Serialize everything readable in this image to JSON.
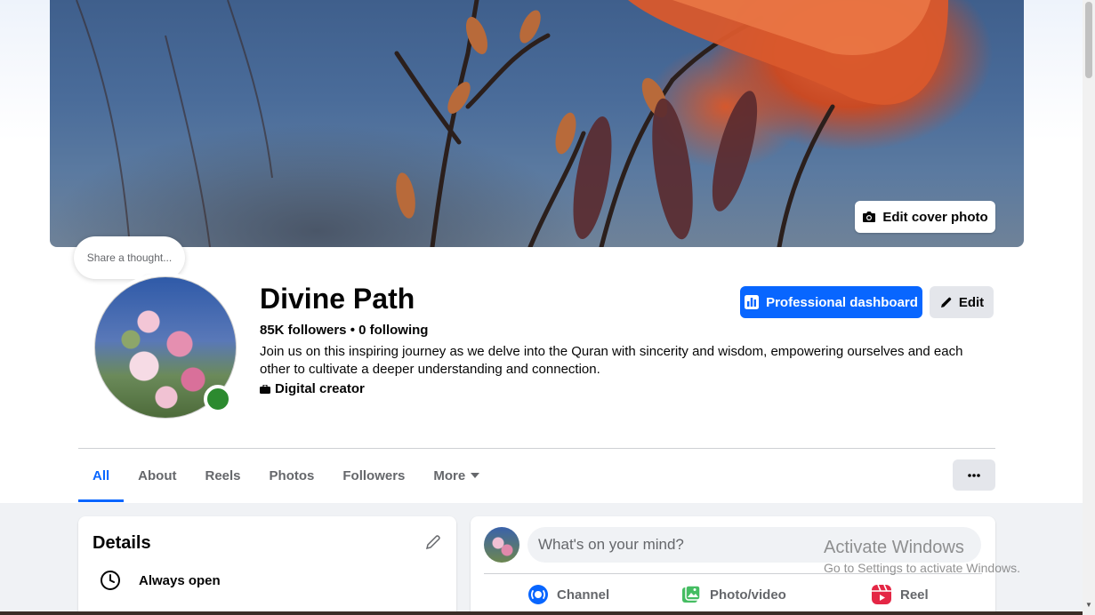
{
  "cover": {
    "edit_label": "Edit cover photo"
  },
  "thought_bubble": {
    "text": "Share a thought..."
  },
  "profile": {
    "name": "Divine Path",
    "followers": "85K followers",
    "separator": " • ",
    "following": "0 following",
    "bio": "Join us on this inspiring journey as we delve into the Quran with sincerity and wisdom, empowering ourselves and each other to cultivate a deeper understanding and connection.",
    "category": "Digital creator",
    "online_status_color": "#2c8a2f"
  },
  "actions": {
    "professional_dashboard": "Professional dashboard",
    "edit": "Edit"
  },
  "tabs": [
    {
      "label": "All",
      "active": true
    },
    {
      "label": "About",
      "active": false
    },
    {
      "label": "Reels",
      "active": false
    },
    {
      "label": "Photos",
      "active": false
    },
    {
      "label": "Followers",
      "active": false
    },
    {
      "label": "More",
      "active": false
    }
  ],
  "details": {
    "title": "Details",
    "hours": "Always open"
  },
  "composer": {
    "placeholder": "What's on your mind?",
    "actions": [
      {
        "label": "Channel",
        "icon": "channel-icon"
      },
      {
        "label": "Photo/video",
        "icon": "photo-video-icon"
      },
      {
        "label": "Reel",
        "icon": "reel-icon"
      }
    ]
  },
  "watermark": {
    "title": "Activate Windows",
    "subtitle": "Go to Settings to activate Windows."
  },
  "colors": {
    "accent": "#0866ff",
    "background": "#f0f2f5",
    "secondary_text": "#65676b"
  }
}
